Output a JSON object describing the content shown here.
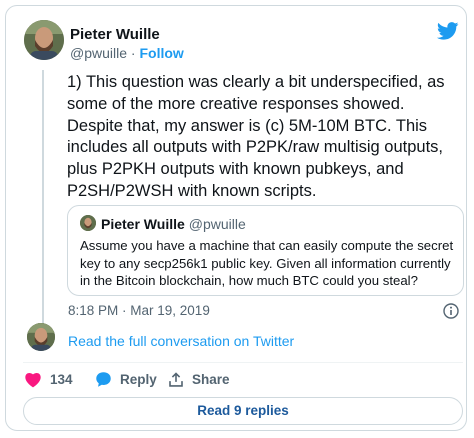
{
  "author": {
    "name": "Pieter Wuille",
    "handle": "@pwuille",
    "separator": "·",
    "follow_label": "Follow"
  },
  "tweet": {
    "text": "1) This question was clearly a bit underspecified, as\nsome of the more creative responses showed.\nDespite that, my answer is (c) 5M-10M BTC. This\nincludes all outputs with P2PK/raw multisig outputs,\nplus P2PKH outputs with known pubkeys, and\nP2SH/P2WSH with known scripts.",
    "timestamp": "8:18 PM · Mar 19, 2019"
  },
  "quoted_tweet": {
    "name": "Pieter Wuille",
    "handle": "@pwuille",
    "text": "Assume you have a machine that can easily compute the secret key to any secp256k1 public key. Given all information currently in the Bitcoin blockchain, how much BTC could you steal?"
  },
  "conversation_link": "Read the full conversation on Twitter",
  "actions": {
    "like_count": "134",
    "reply_label": "Reply",
    "share_label": "Share"
  },
  "read_replies_label": "Read 9 replies",
  "icons": {
    "brand": "twitter-bird-icon",
    "info": "info-icon",
    "like": "heart-icon",
    "reply": "speech-bubble-icon",
    "share": "share-icon"
  },
  "colors": {
    "accent": "#1d9bf0",
    "like": "#f91880",
    "text": "#0f1419",
    "muted": "#536471",
    "border": "#cfd9de"
  }
}
